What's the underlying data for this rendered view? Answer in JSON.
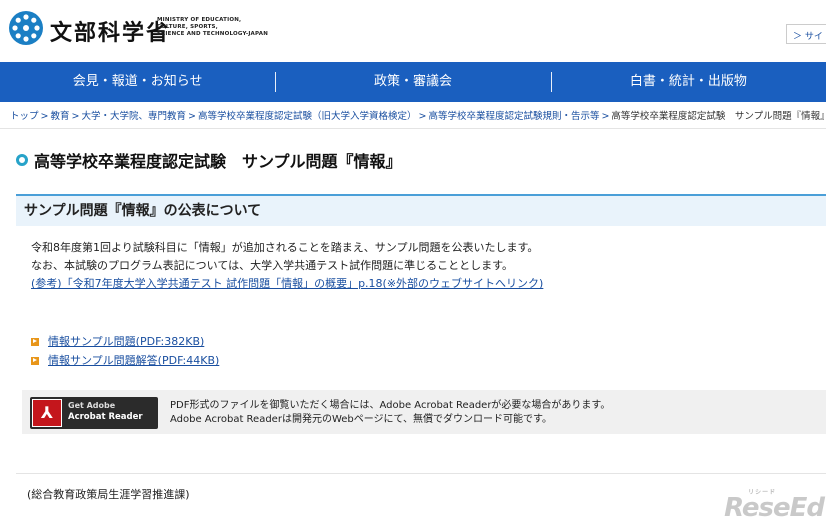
{
  "header": {
    "logo_title": "文部科学省",
    "logo_en": [
      "MINISTRY OF EDUCATION,",
      "CULTURE, SPORTS,",
      "SCIENCE AND TECHNOLOGY-JAPAN"
    ],
    "right_link": "＞ サイ"
  },
  "nav": {
    "items": [
      {
        "label": "会見・報道・お知らせ"
      },
      {
        "label": "政策・審議会"
      },
      {
        "label": "白書・統計・出版物"
      }
    ]
  },
  "breadcrumb": {
    "items": [
      "トップ",
      "教育",
      "大学・大学院、専門教育",
      "高等学校卒業程度認定試験（旧大学入学資格検定）",
      "高等学校卒業程度認定試験規則・告示等"
    ],
    "current": "高等学校卒業程度認定試験　サンプル問題『情報』"
  },
  "page_title": "高等学校卒業程度認定試験　サンプル問題『情報』",
  "section": {
    "heading": "サンプル問題『情報』の公表について",
    "paragraph1": "令和8年度第1回より試験科目に「情報」が追加されることを踏まえ、サンプル問題を公表いたします。",
    "paragraph2": "なお、本試験のプログラム表記については、大学入学共通テスト試作問題に準じることとします。",
    "ref_link": "(参考)「令和7年度大学入学共通テスト 試作問題「情報」の概要」p.18(※外部のウェブサイトへリンク)"
  },
  "documents": [
    {
      "label": "情報サンプル問題(PDF:382KB)"
    },
    {
      "label": "情報サンプル問題解答(PDF:44KB)"
    }
  ],
  "acrobat": {
    "badge_line1": "Get Adobe",
    "badge_line2": "Acrobat Reader",
    "desc1": "PDF形式のファイルを御覧いただく場合には、Adobe Acrobat Readerが必要な場合があります。",
    "desc2": "Adobe Acrobat Readerは開発元のWebページにて、無償でダウンロード可能です。"
  },
  "footer": {
    "org": "(総合教育政策局生涯学習推進課)"
  },
  "watermark": {
    "text": "ReseEd",
    "sub": "リシード"
  }
}
